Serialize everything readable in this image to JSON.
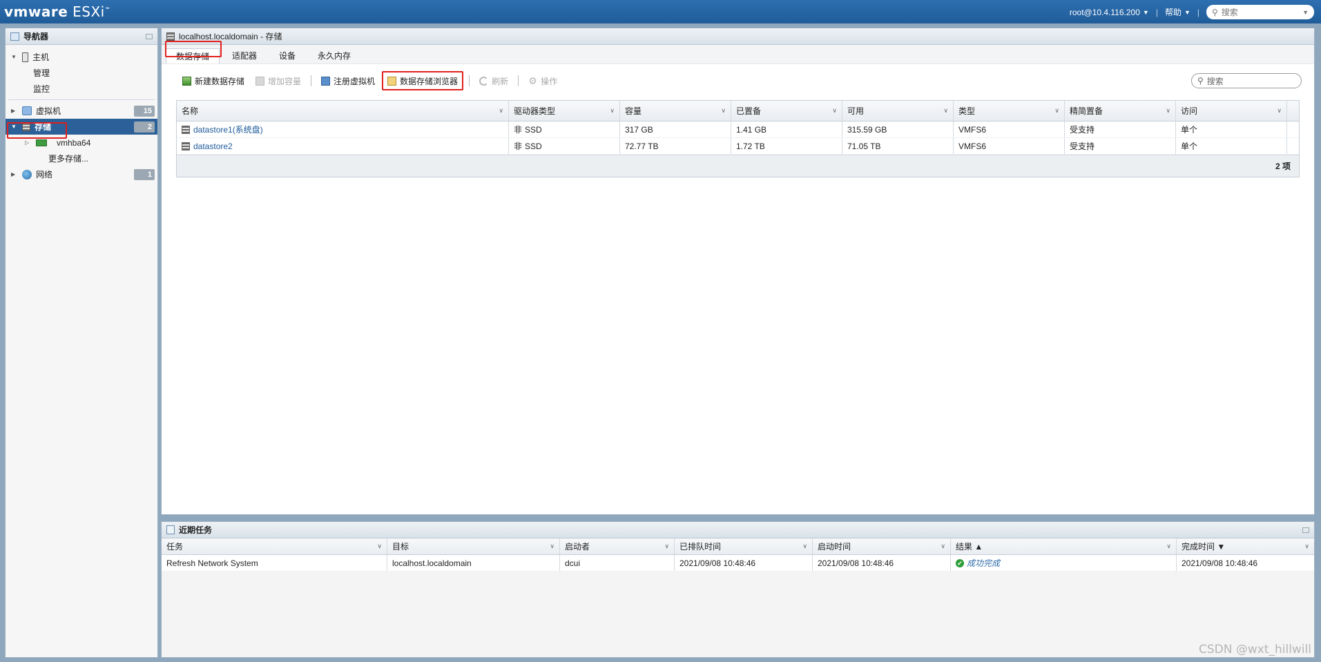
{
  "topbar": {
    "brand_bold": "vmware",
    "brand_rest": " ESXi",
    "brand_tm": "™",
    "user": "root@10.4.116.200",
    "help": "帮助",
    "sep": "|",
    "search_placeholder": "搜索"
  },
  "navigator": {
    "title": "导航器",
    "host": "主机",
    "manage": "管理",
    "monitor": "监控",
    "vms": {
      "label": "虚拟机",
      "count": "15"
    },
    "storage": {
      "label": "存储",
      "count": "2"
    },
    "hba": "vmhba64",
    "more_storage": "更多存储...",
    "network": {
      "label": "网络",
      "count": "1"
    }
  },
  "main": {
    "title": "localhost.localdomain - 存储",
    "tabs": [
      "数据存储",
      "适配器",
      "设备",
      "永久内存"
    ],
    "toolbar": {
      "new_datastore": "新建数据存储",
      "increase_capacity": "增加容量",
      "register_vm": "注册虚拟机",
      "datastore_browser": "数据存储浏览器",
      "refresh": "刷新",
      "actions": "操作"
    },
    "search_placeholder": "搜索",
    "table": {
      "columns": [
        "名称",
        "驱动器类型",
        "容量",
        "已置备",
        "可用",
        "类型",
        "精简置备",
        "访问"
      ],
      "rows": [
        [
          "datastore1(系统盘)",
          "SSD",
          "317 GB",
          "1.41 GB",
          "315.59 GB",
          "VMFS6",
          "受支持",
          "单个"
        ],
        [
          "datastore2",
          "SSD",
          "72.77 TB",
          "1.72 TB",
          "71.05 TB",
          "VMFS6",
          "受支持",
          "单个"
        ]
      ],
      "drive_glyph": "非",
      "footer": "2 项"
    }
  },
  "tasks": {
    "title": "近期任务",
    "columns": [
      "任务",
      "目标",
      "启动者",
      "已排队时间",
      "启动时间",
      "结果 ▲",
      "完成时间 ▼"
    ],
    "rows": [
      [
        "Refresh Network System",
        "localhost.localdomain",
        "dcui",
        "2021/09/08 10:48:46",
        "2021/09/08 10:48:46",
        "成功完成",
        "2021/09/08 10:48:46"
      ]
    ]
  },
  "watermark": "CSDN @wxt_hillwill",
  "colors": {
    "accent": "#1f5c99",
    "selected": "#2b6098",
    "highlight": "#e0201c"
  }
}
